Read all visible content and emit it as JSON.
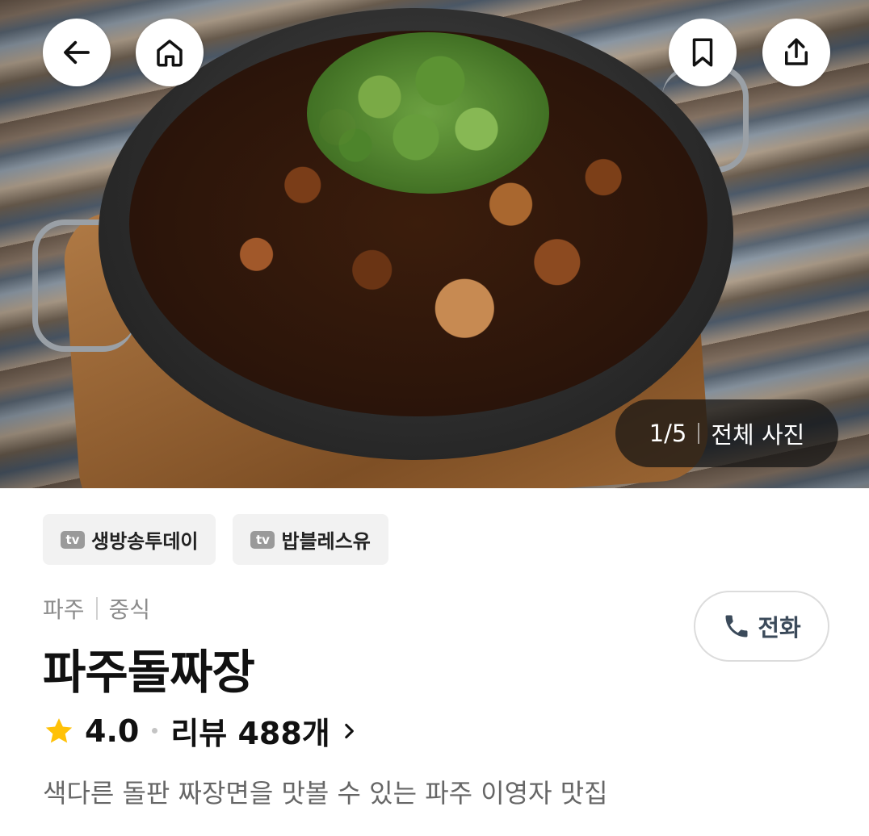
{
  "hero": {
    "photo_index": "1/5",
    "all_photos_label": "전체 사진"
  },
  "top_bar": {
    "back_icon": "arrow-left-icon",
    "home_icon": "home-icon",
    "bookmark_icon": "bookmark-icon",
    "share_icon": "share-icon"
  },
  "tags": [
    {
      "badge": "tv",
      "label": "생방송투데이"
    },
    {
      "badge": "tv",
      "label": "밥블레스유"
    }
  ],
  "restaurant": {
    "region": "파주",
    "category": "중식",
    "name": "파주돌짜장",
    "rating": "4.0",
    "review_label": "리뷰 488개",
    "description": "색다른 돌판 짜장면을 맛볼 수 있는 파주 이영자 맛집"
  },
  "call": {
    "label": "전화",
    "icon": "phone-icon"
  },
  "colors": {
    "star": "#FFC107",
    "call_text": "#3B4A5A"
  }
}
